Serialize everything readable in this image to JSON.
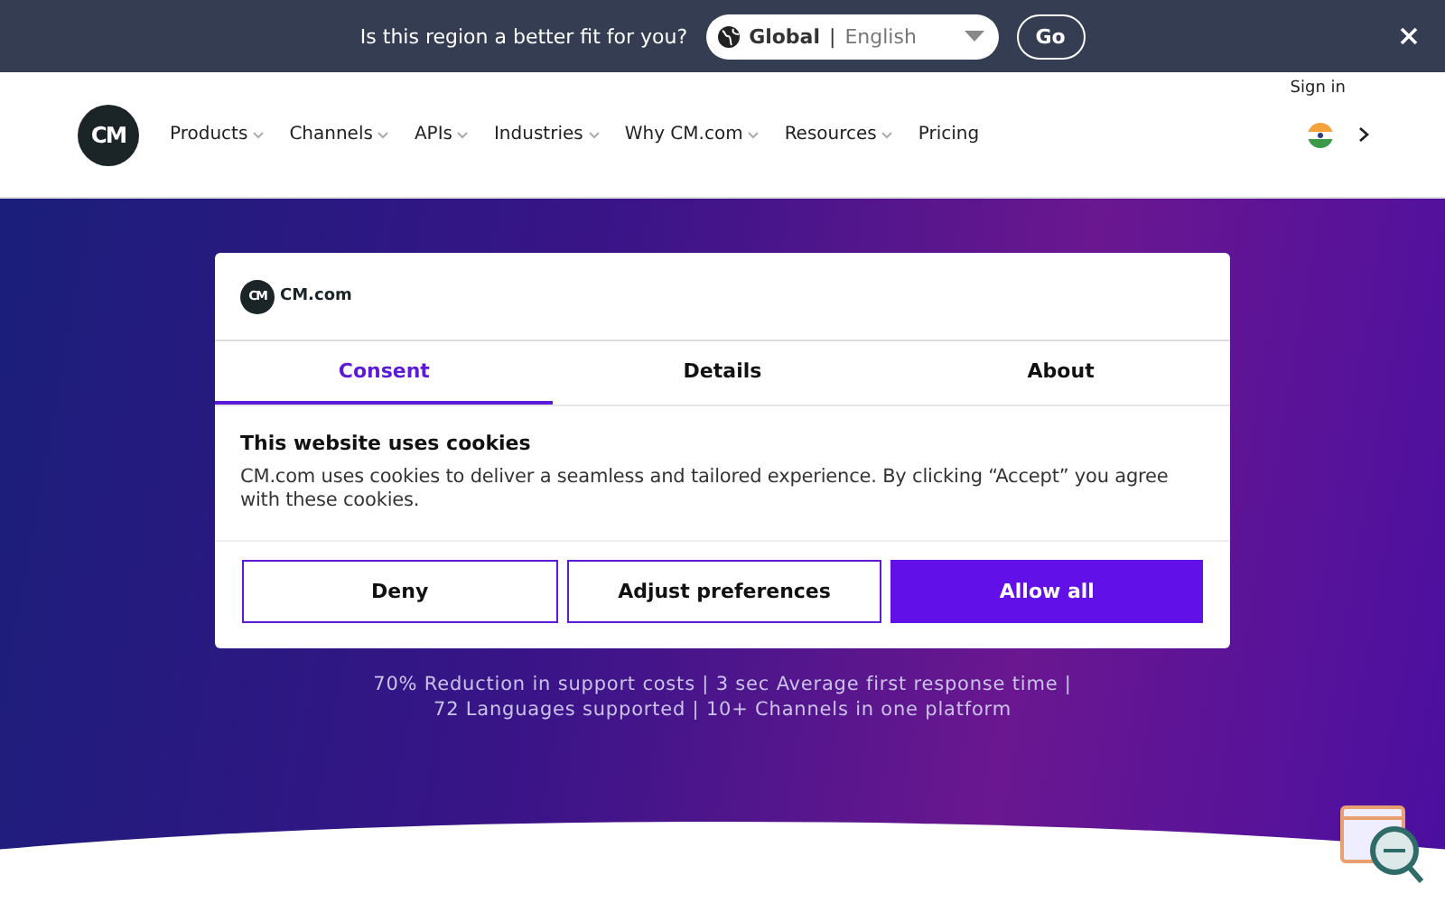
{
  "region_bar": {
    "question": "Is this region a better fit for you?",
    "region": "Global",
    "separator": "|",
    "language": "English",
    "go": "Go"
  },
  "header": {
    "sign_in": "Sign in",
    "logo": "CM",
    "nav": [
      {
        "label": "Products",
        "kind": "dropdown"
      },
      {
        "label": "Channels",
        "kind": "dropdown"
      },
      {
        "label": "APIs",
        "kind": "dropdown"
      },
      {
        "label": "Industries",
        "kind": "dropdown"
      },
      {
        "label": "Why CM.com",
        "kind": "dropdown"
      },
      {
        "label": "Resources",
        "kind": "dropdown"
      },
      {
        "label": "Pricing",
        "kind": "link"
      }
    ]
  },
  "hero": {
    "stats": [
      "70% Reduction in support costs | 3 sec Average first response time |",
      "72 Languages supported | 10+ Channels in one platform"
    ]
  },
  "cookie_dialog": {
    "logo": "CM",
    "brand": "CM.com",
    "tabs": [
      {
        "label": "Consent",
        "selected": true
      },
      {
        "label": "Details",
        "selected": false
      },
      {
        "label": "About",
        "selected": false
      }
    ],
    "heading": "This website uses cookies",
    "body": "CM.com uses cookies to deliver a seamless and tailored experience. By clicking “Accept” you agree with these cookies.",
    "buttons": [
      {
        "label": "Deny",
        "kind": "outline"
      },
      {
        "label": "Adjust preferences",
        "kind": "outline"
      },
      {
        "label": "Allow all",
        "kind": "primary"
      }
    ]
  }
}
